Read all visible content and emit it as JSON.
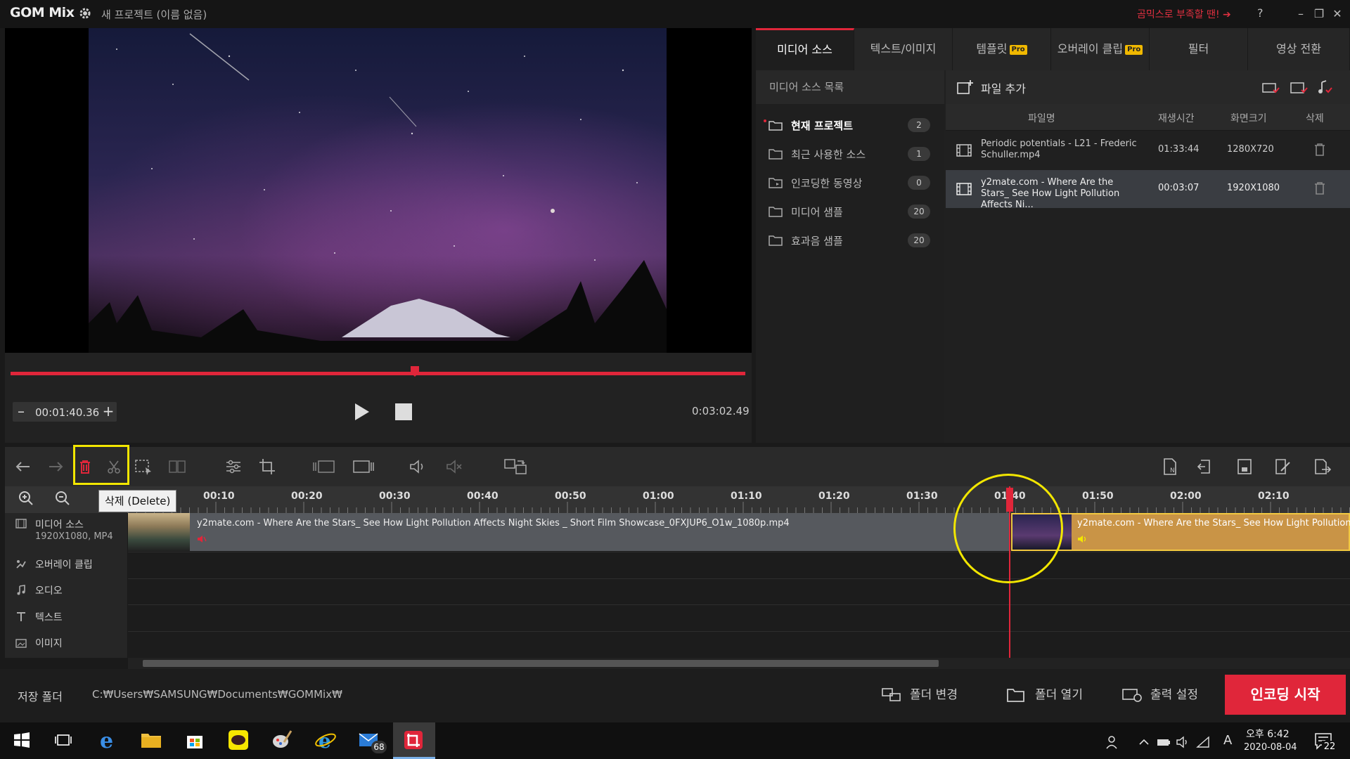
{
  "app": {
    "logo": "GOM Mix",
    "project_title": "새 프로젝트 (이름 없음)",
    "promo_text": "곰믹스로 부족할 땐!",
    "help": "?",
    "window_buttons": [
      "–",
      "❐",
      "✕"
    ]
  },
  "preview": {
    "current_time": "00:01:40.36",
    "total_time": "0:03:02.49",
    "minus": "–",
    "plus": "+",
    "progress_fraction": 0.55
  },
  "tabs": [
    {
      "label": "미디어 소스",
      "pro": false
    },
    {
      "label": "텍스트/이미지",
      "pro": false
    },
    {
      "label": "템플릿",
      "pro": true
    },
    {
      "label": "오버레이 클립",
      "pro": true
    },
    {
      "label": "필터",
      "pro": false
    },
    {
      "label": "영상 전환",
      "pro": false
    }
  ],
  "pro_badge": "Pro",
  "media_source": {
    "list_title": "미디어 소스 목록",
    "folders": [
      {
        "label": "현재 프로젝트",
        "count": "2"
      },
      {
        "label": "최근 사용한 소스",
        "count": "1"
      },
      {
        "label": "인코딩한 동영상",
        "count": "0"
      },
      {
        "label": "미디어 샘플",
        "count": "20"
      },
      {
        "label": "효과음 샘플",
        "count": "20"
      }
    ],
    "add_file": "파일 추가",
    "columns": {
      "name": "파일명",
      "duration": "재생시간",
      "size": "화면크기",
      "delete": "삭제"
    },
    "files": [
      {
        "name": "Periodic potentials - L21 - Frederic Schuller.mp4",
        "duration": "01:33:44",
        "size": "1280X720"
      },
      {
        "name": "y2mate.com - Where Are the Stars_ See How Light Pollution Affects Ni...",
        "duration": "00:03:07",
        "size": "1920X1080"
      }
    ]
  },
  "toolbar": {
    "tooltip": "삭제 (Delete)"
  },
  "ruler": {
    "ticks": [
      "00:10",
      "00:20",
      "00:30",
      "00:40",
      "00:50",
      "01:00",
      "01:10",
      "01:20",
      "01:30",
      "01:40",
      "01:50",
      "02:00",
      "02:10"
    ]
  },
  "tracks": {
    "media": {
      "label": "미디어 소스",
      "sub": "1920X1080, MP4"
    },
    "overlay": "오버레이 클립",
    "audio": "오디오",
    "text": "텍스트",
    "image": "이미지"
  },
  "clips": {
    "a": "y2mate.com - Where Are the Stars_ See How Light Pollution Affects Night Skies _ Short Film Showcase_0FXJUP6_O1w_1080p.mp4",
    "b": "y2mate.com - Where Are the Stars_ See How Light Pollution"
  },
  "bottom": {
    "save_label": "저장 폴더",
    "save_path": "C:₩Users₩SAMSUNG₩Documents₩GOMMix₩",
    "change_folder": "폴더 변경",
    "open_folder": "폴더 열기",
    "output_settings": "출력 설정",
    "encode": "인코딩 시작"
  },
  "taskbar": {
    "mail_badge": "68",
    "clock_time": "오후 6:42",
    "clock_date": "2020-08-04",
    "ime": "A",
    "notif_count": "22"
  },
  "colors": {
    "accent": "#e0263a",
    "highlight": "#f2e600",
    "pro": "#f0b800",
    "selected_clip": "#c99446"
  }
}
